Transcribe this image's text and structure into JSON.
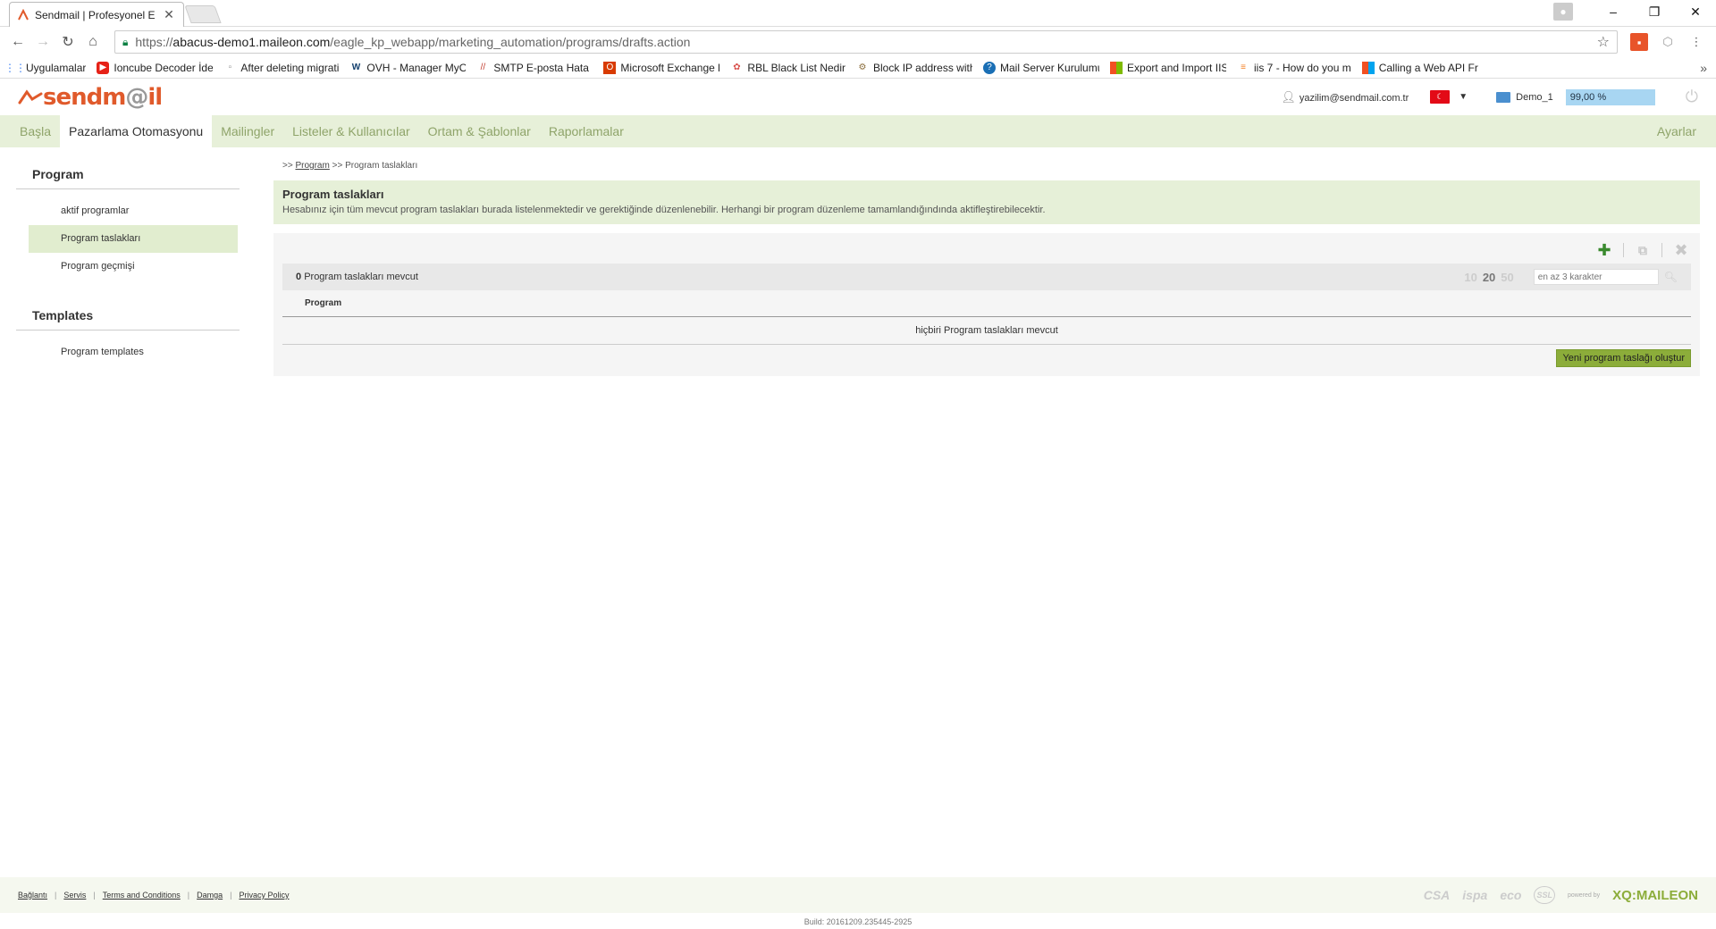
{
  "browser": {
    "tab_title": "Sendmail | Profesyonel E",
    "url_prefix": "https://",
    "url_host": "abacus-demo1.maileon.com",
    "url_path": "/eagle_kp_webapp/marketing_automation/programs/drafts.action",
    "bookmarks": [
      "Uygulamalar",
      "Ioncube Decoder İdeo",
      "After deleting migrati",
      "OVH - Manager MyOV",
      "SMTP E-posta Hata Ko",
      "Microsoft Exchange h",
      "RBL Black List Nedir",
      "Block IP address with",
      "Mail Server Kurulumu",
      "Export and Import IIS",
      "iis 7 - How do you m",
      "Calling a Web API Fro"
    ]
  },
  "header": {
    "logo_main": "sendm",
    "logo_at": "@",
    "logo_end": "il",
    "user_email": "yazilim@sendmail.com.tr",
    "account": "Demo_1",
    "quota": "99,00 %"
  },
  "nav": {
    "items": [
      "Başla",
      "Pazarlama Otomasyonu",
      "Mailingler",
      "Listeler & Kullanıcılar",
      "Ortam & Şablonlar",
      "Raporlamalar"
    ],
    "settings": "Ayarlar"
  },
  "sidebar": {
    "section1": "Program",
    "items1": [
      "aktif programlar",
      "Program taslakları",
      "Program geçmişi"
    ],
    "section2": "Templates",
    "items2": [
      "Program templates"
    ]
  },
  "main": {
    "breadcrumb_prefix": ">>",
    "breadcrumb_link": "Program",
    "breadcrumb_sep": ">>",
    "breadcrumb_current": "Program taslakları",
    "title": "Program taslakları",
    "description": "Hesabınız için tüm mevcut program taslakları burada listelenmektedir ve gerektiğinde düzenlenebilir. Herhangi bir program düzenleme tamamlandığındında aktifleştirebilecektir.",
    "count_num": "0",
    "count_text": "Program taslakları mevcut",
    "pager": [
      "10",
      "20",
      "50"
    ],
    "search_placeholder": "en az 3 karakter",
    "column_program": "Program",
    "empty_text": "hiçbiri Program taslakları mevcut",
    "create_button": "Yeni program taslağı oluştur"
  },
  "footer": {
    "links": [
      "Bağlantı",
      "Servis",
      "Terms and Conditions",
      "Damga",
      "Privacy Policy"
    ],
    "partners": [
      "CSA",
      "ispa",
      "eco",
      "SSL"
    ],
    "powered_by": "powered by",
    "brand": "XQ:MAILEON",
    "build": "Build: 20161209.235445-2925"
  },
  "colors": {
    "nav_bg": "#e7f0d9",
    "accent_green": "#8cad3a",
    "logo_orange": "#e05a2b"
  }
}
